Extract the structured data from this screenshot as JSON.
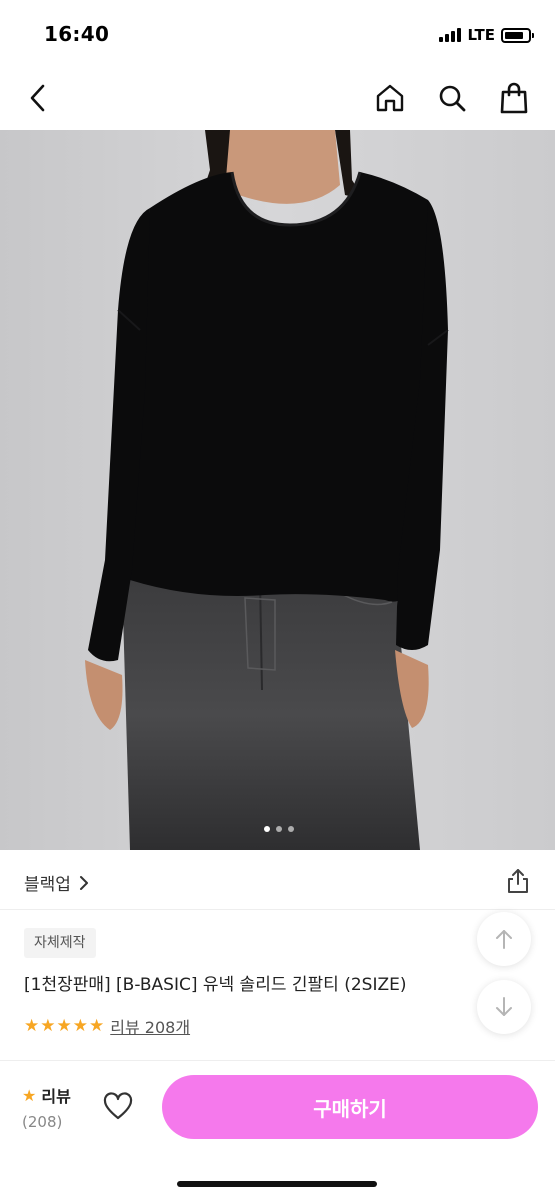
{
  "status_bar": {
    "time": "16:40",
    "network": "LTE",
    "battery_level": 0.8
  },
  "nav": {
    "back_icon": "chevron-left-icon",
    "home_icon": "home-icon",
    "search_icon": "search-icon",
    "cart_icon": "shopping-bag-icon"
  },
  "product": {
    "brand": "블랙업",
    "badge": "자체제작",
    "title": "[1천장판매] [B-BASIC] 유넥 솔리드 긴팔티 (2SIZE)",
    "rating_stars": 5,
    "review_link": "리뷰 208개",
    "image_index": 1,
    "image_count": 3
  },
  "bottom_bar": {
    "review_label": "리뷰",
    "review_count": "(208)",
    "buy_label": "구매하기",
    "buy_color": "#f579ec",
    "star_color": "#f7a623"
  }
}
